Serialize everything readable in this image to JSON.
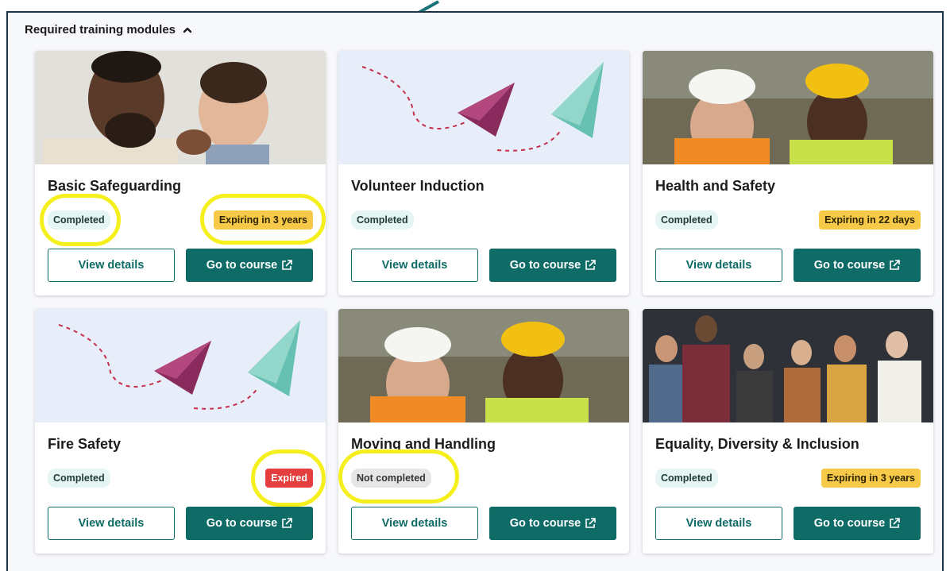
{
  "section": {
    "title": "Required training modules"
  },
  "colors": {
    "accent": "#0f6b66",
    "expiry": "#f7c948",
    "expired": "#e53e3e",
    "completed_bg": "#e4f5f3",
    "highlight": "#f6ef1e"
  },
  "cards": [
    {
      "title": "Basic Safeguarding",
      "image": "parent-and-baby-photo",
      "status": "Completed",
      "expiry": "Expiring in 3 years",
      "view_label": "View details",
      "go_label": "Go to course"
    },
    {
      "title": "Volunteer Induction",
      "image": "paper-planes-illustration",
      "status": "Completed",
      "expiry": "",
      "view_label": "View details",
      "go_label": "Go to course"
    },
    {
      "title": "Health and Safety",
      "image": "hard-hat-workers-photo",
      "status": "Completed",
      "expiry": "Expiring in 22 days",
      "view_label": "View details",
      "go_label": "Go to course"
    },
    {
      "title": "Fire Safety",
      "image": "paper-planes-illustration",
      "status": "Completed",
      "expiry": "Expired",
      "view_label": "View details",
      "go_label": "Go to course"
    },
    {
      "title": "Moving and Handling",
      "image": "hard-hat-workers-photo",
      "status": "Not completed",
      "expiry": "",
      "view_label": "View details",
      "go_label": "Go to course"
    },
    {
      "title": "Equality, Diversity & Inclusion",
      "image": "group-of-people-photo",
      "status": "Completed",
      "expiry": "Expiring in 3 years",
      "view_label": "View details",
      "go_label": "Go to course"
    }
  ]
}
